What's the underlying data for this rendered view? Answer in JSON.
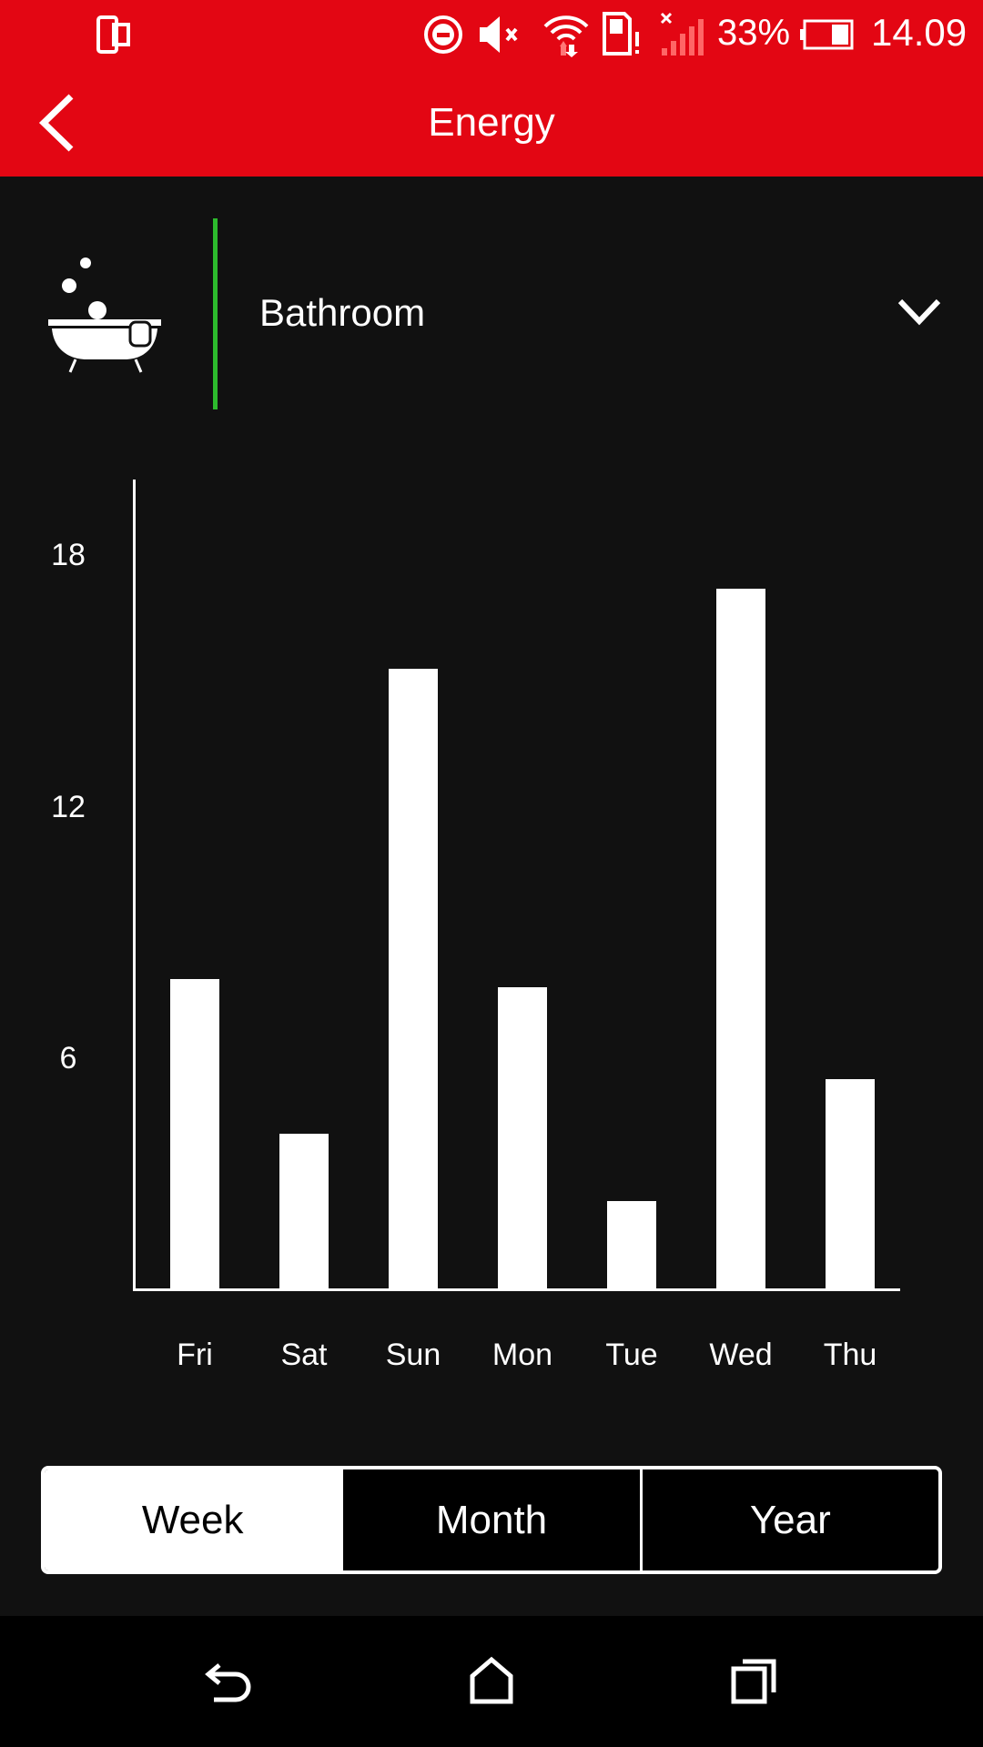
{
  "status_bar": {
    "battery": "33%",
    "time": "14.09",
    "icons": [
      "screen-mirror-icon",
      "do-not-disturb-icon",
      "mute-icon",
      "wifi-icon",
      "sim-alert-icon",
      "signal-icon",
      "battery-icon"
    ]
  },
  "header": {
    "title": "Energy",
    "back_icon": "chevron-left-icon",
    "color": "#e30613"
  },
  "room_selector": {
    "icon": "bathtub-icon",
    "label": "Bathroom",
    "accent": "#2dbb2d",
    "dropdown_icon": "chevron-down-icon"
  },
  "chart_data": {
    "type": "bar",
    "categories": [
      "Fri",
      "Sat",
      "Sun",
      "Mon",
      "Tue",
      "Wed",
      "Thu"
    ],
    "values": [
      7.4,
      3.7,
      14.8,
      7.2,
      2.1,
      16.7,
      5.0
    ],
    "yticks": [
      "18",
      "12",
      "6"
    ],
    "ytick_values": [
      18,
      12,
      6
    ],
    "ylim": [
      0,
      19.3
    ],
    "grid": false,
    "bar_color": "#ffffff"
  },
  "period_tabs": {
    "items": [
      "Week",
      "Month",
      "Year"
    ],
    "selected": "Week"
  },
  "nav_bar": {
    "icons": [
      "back-icon",
      "home-icon",
      "recents-icon"
    ]
  }
}
